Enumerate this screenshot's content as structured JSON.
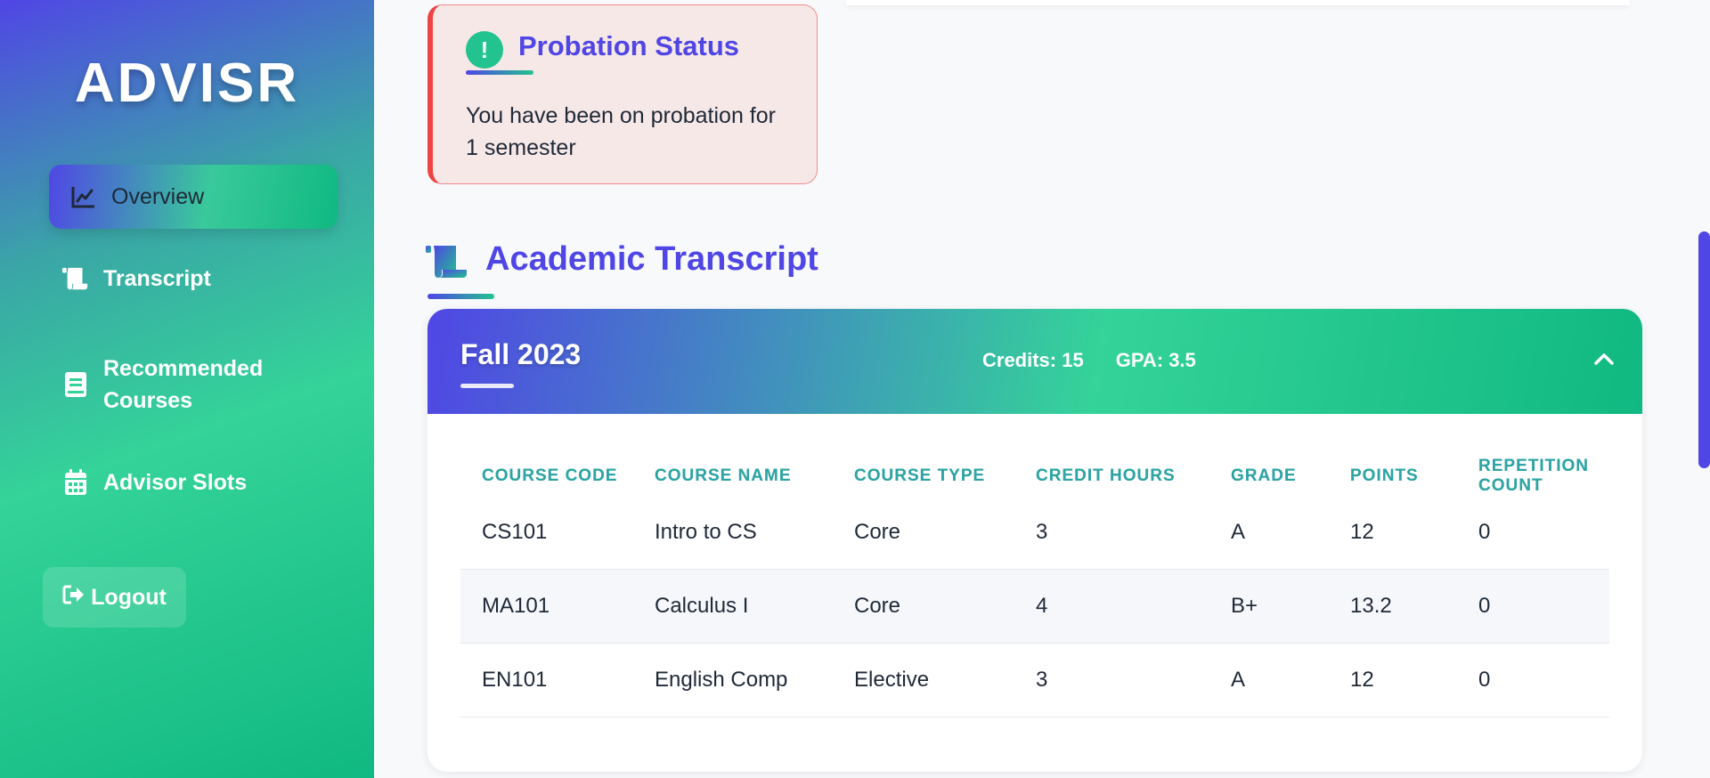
{
  "brand": "ADVISR",
  "sidebar": {
    "items": [
      {
        "label": "Overview",
        "icon": "chart-line-icon",
        "active": true
      },
      {
        "label": "Transcript",
        "icon": "scroll-icon"
      },
      {
        "label": "Recommended Courses",
        "icon": "book-icon"
      },
      {
        "label": "Advisor Slots",
        "icon": "calendar-icon"
      }
    ],
    "logout_label": "Logout"
  },
  "probation": {
    "title": "Probation Status",
    "text": "You have been on probation for 1 semester"
  },
  "transcript": {
    "title": "Academic Transcript",
    "semester": {
      "name": "Fall 2023",
      "credits": "Credits: 15",
      "gpa": "GPA: 3.5",
      "columns": [
        "COURSE CODE",
        "COURSE NAME",
        "COURSE TYPE",
        "CREDIT HOURS",
        "GRADE",
        "POINTS",
        "REPETITION COUNT"
      ],
      "rows": [
        [
          "CS101",
          "Intro to CS",
          "Core",
          "3",
          "A",
          "12",
          "0"
        ],
        [
          "MA101",
          "Calculus I",
          "Core",
          "4",
          "B+",
          "13.2",
          "0"
        ],
        [
          "EN101",
          "English Comp",
          "Elective",
          "3",
          "A",
          "12",
          "0"
        ]
      ]
    }
  },
  "colors": {
    "primary": "#4f46e5",
    "accent": "#10b981",
    "danger": "#ef4444"
  }
}
